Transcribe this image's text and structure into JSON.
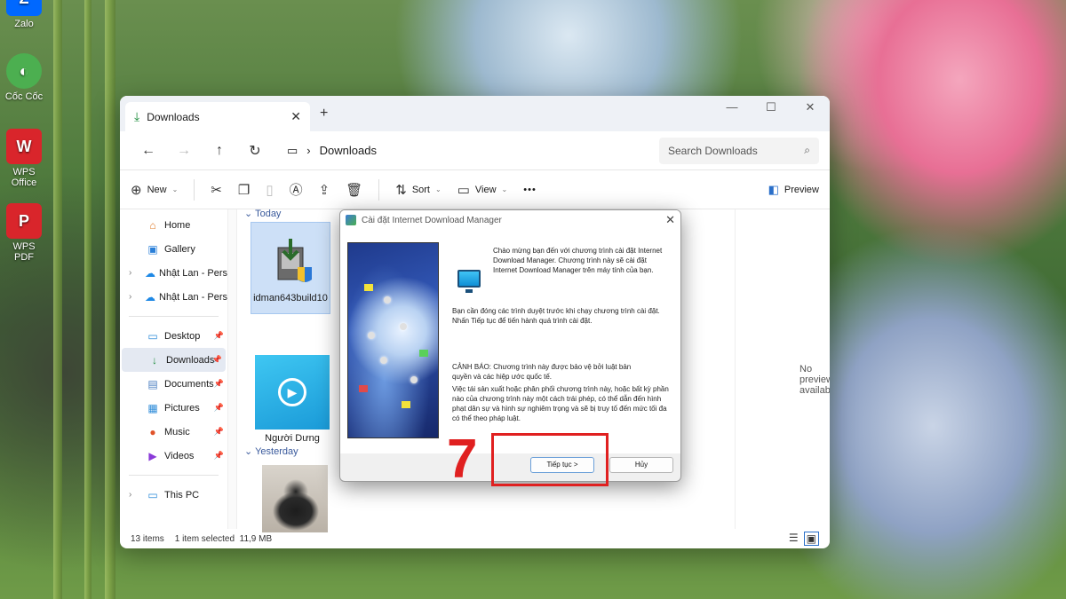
{
  "desktop": {
    "icons": [
      {
        "label": "Zalo",
        "glyph": "Z",
        "color": "#0068ff"
      },
      {
        "label": "Cốc Cốc",
        "glyph": "◐",
        "color": "#4caf50"
      },
      {
        "label": "WPS Office",
        "glyph": "W",
        "color": "#d9252b"
      },
      {
        "label": "WPS PDF",
        "glyph": "P",
        "color": "#d9252b"
      }
    ]
  },
  "explorer": {
    "tab_title": "Downloads",
    "address": "Downloads",
    "search_placeholder": "Search Downloads",
    "toolbar": {
      "new": "New",
      "sort": "Sort",
      "view": "View",
      "more": "•••",
      "preview": "Preview"
    },
    "sidebar": [
      {
        "label": "Home",
        "icon": "home-icon",
        "glyph": "⌂"
      },
      {
        "label": "Gallery",
        "icon": "gallery-icon",
        "glyph": "▣"
      },
      {
        "label": "Nhật Lan - Perso",
        "icon": "cloud-icon",
        "glyph": "☁",
        "expandable": true
      },
      {
        "label": "Nhật Lan - Perso",
        "icon": "cloud-icon",
        "glyph": "☁",
        "expandable": true
      },
      {
        "label": "Desktop",
        "icon": "desktop-icon",
        "glyph": "▭",
        "pinned": true
      },
      {
        "label": "Downloads",
        "icon": "download-icon",
        "glyph": "↓",
        "pinned": true,
        "active": true
      },
      {
        "label": "Documents",
        "icon": "documents-icon",
        "glyph": "▤",
        "pinned": true
      },
      {
        "label": "Pictures",
        "icon": "pictures-icon",
        "glyph": "▦",
        "pinned": true
      },
      {
        "label": "Music",
        "icon": "music-icon",
        "glyph": "●",
        "pinned": true
      },
      {
        "label": "Videos",
        "icon": "videos-icon",
        "glyph": "▶",
        "pinned": true
      },
      {
        "label": "This PC",
        "icon": "pc-icon",
        "glyph": "▭",
        "expandable": true
      }
    ],
    "groups": {
      "today": "Today",
      "yesterday": "Yesterday"
    },
    "files": [
      {
        "name": "idman643build10"
      },
      {
        "name": "Người Dưng"
      }
    ],
    "preview_text": "No preview available.",
    "status": {
      "count": "13 items",
      "selected": "1 item selected",
      "size": "11,9 MB"
    }
  },
  "dialog": {
    "title": "Cài đặt Internet Download Manager",
    "welcome": "Chào mừng bạn đến với chương trình cài đặt Internet Download Manager. Chương trình này sẽ cài đặt Internet Download Manager trên máy tính của bạn.",
    "close_browsers": "Bạn cần đóng các trình duyệt trước khi chạy chương trình cài đặt. Nhấn Tiếp tục để tiến hành quá trình cài đặt.",
    "warning": "CẢNH BÁO: Chương trình này được bảo vệ bởi luật bản quyền và các hiệp ước quốc tế.",
    "legal": "Việc tái sản xuất hoặc phân phối chương trình này, hoặc bất kỳ phần nào của chương trình này một cách trái phép, có thể dẫn đến hình phạt dân sự và hình sự nghiêm trọng và sẽ bị truy tố đến mức tối đa có thể theo pháp luật.",
    "next_button": "Tiếp tục >",
    "cancel_button": "Hủy"
  },
  "annotation": {
    "step": "7",
    "color": "#e02020"
  }
}
